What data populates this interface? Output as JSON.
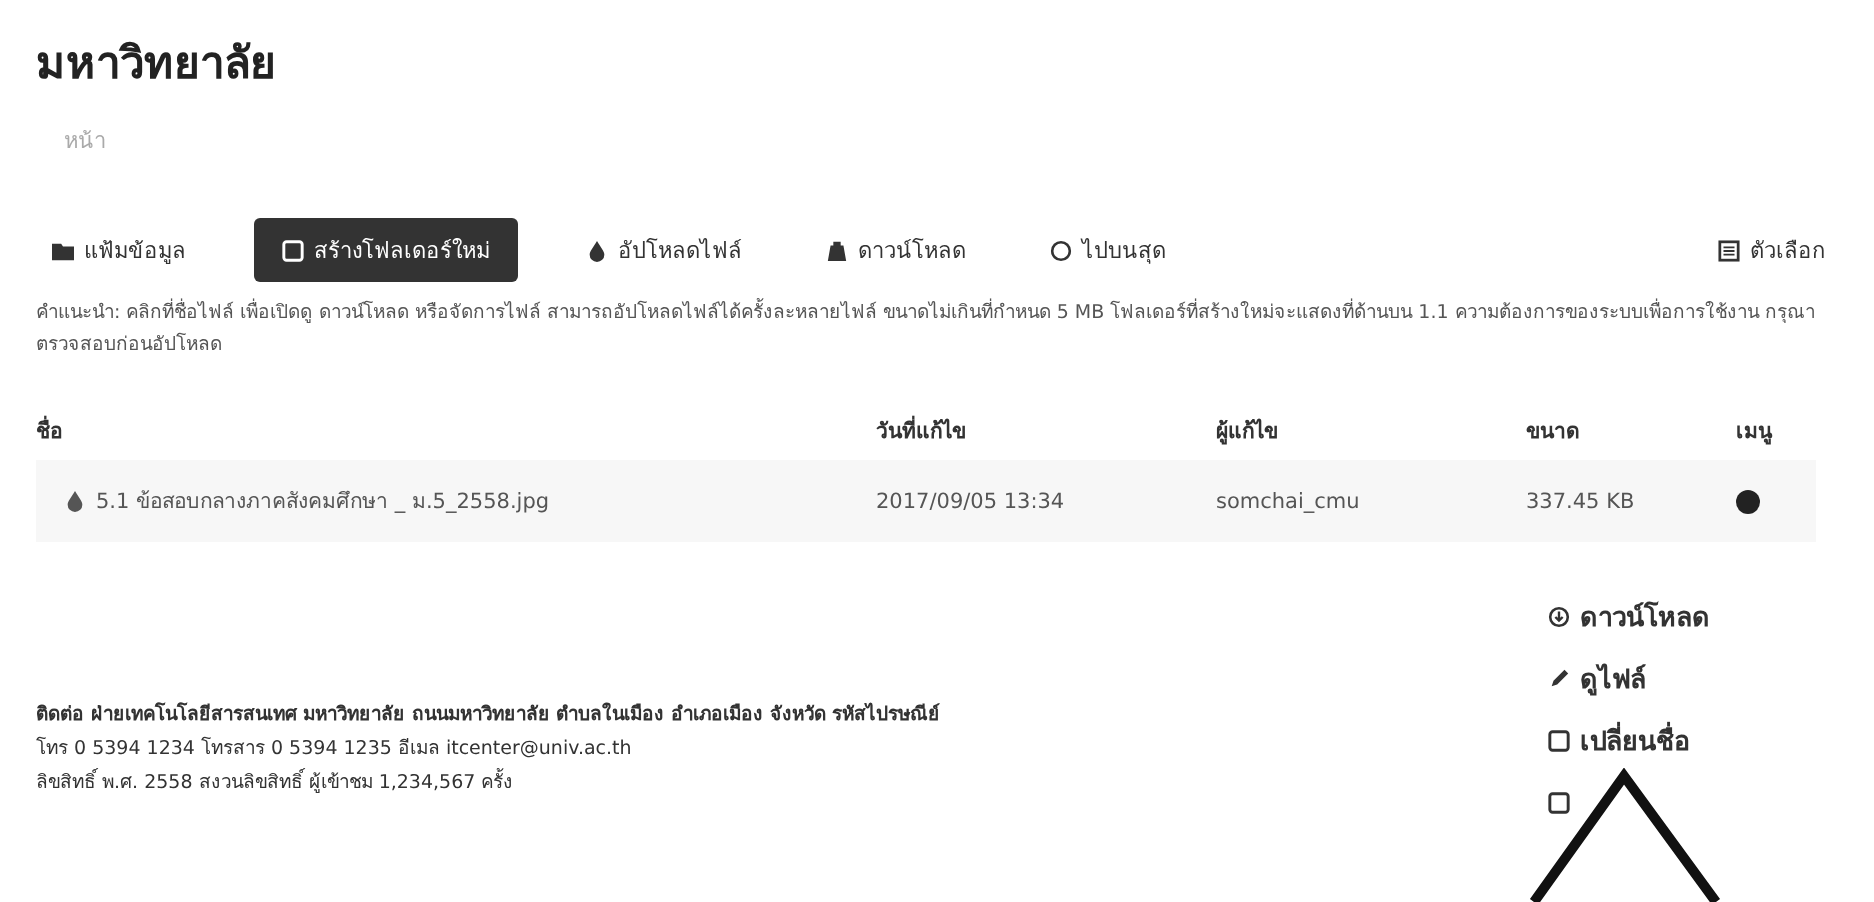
{
  "page": {
    "title": "มหาวิทยาลัย",
    "subtitle": "หน้า"
  },
  "toolbar": {
    "tabs": [
      {
        "label": "แฟ้มข้อมูล",
        "kind": "folder",
        "selected": false
      },
      {
        "label": "สร้างโฟลเดอร์ใหม่",
        "kind": "new",
        "selected": true
      },
      {
        "label": "อัปโหลดไฟล์",
        "kind": "upload",
        "selected": false
      },
      {
        "label": "ดาวน์โหลด",
        "kind": "download",
        "selected": false
      },
      {
        "label": "ไปบนสุด",
        "kind": "top",
        "selected": false
      }
    ],
    "options": {
      "label": "ตัวเลือก"
    }
  },
  "description": "คำแนะนำ: คลิกที่ชื่อไฟล์ เพื่อเปิดดู ดาวน์โหลด หรือจัดการไฟล์ สามารถอัปโหลดไฟล์ได้ครั้งละหลายไฟล์ ขนาดไม่เกินที่กำหนด 5 MB โฟลเดอร์ที่สร้างใหม่จะแสดงที่ด้านบน 1.1 ความต้องการของระบบเพื่อการใช้งาน กรุณาตรวจสอบก่อนอัปโหลด",
  "table": {
    "columns": [
      "ชื่อ",
      "วันที่แก้ไข",
      "ผู้แก้ไข",
      "ขนาด",
      "เมนู"
    ],
    "rows": [
      {
        "name": "5.1 ข้อสอบกลางภาคสังคมศึกษา _ ม.5_2558.jpg",
        "modified": "2017/09/05 13:34",
        "owner": "somchai_cmu",
        "size": "337.45 KB"
      }
    ]
  },
  "menu": {
    "items": [
      {
        "label": "ดาวน์โหลด",
        "kind": "download"
      },
      {
        "label": "ดูไฟล์",
        "kind": "edit"
      },
      {
        "label": "เปลี่ยนชื่อ",
        "kind": "rename"
      },
      {
        "kind": "delete"
      }
    ]
  },
  "footer": {
    "lines": [
      "ติดต่อ ฝ่ายเทคโนโลยีสารสนเทศ มหาวิทยาลัย ถนนมหาวิทยาลัย ตำบลในเมือง อำเภอเมือง จังหวัด รหัสไปรษณีย์",
      "โทร 0 5394 1234 โทรสาร 0 5394 1235 อีเมล itcenter@univ.ac.th",
      "ลิขสิทธิ์ พ.ศ. 2558 สงวนลิขสิทธิ์ ผู้เข้าชม 1,234,567 ครั้ง"
    ]
  }
}
